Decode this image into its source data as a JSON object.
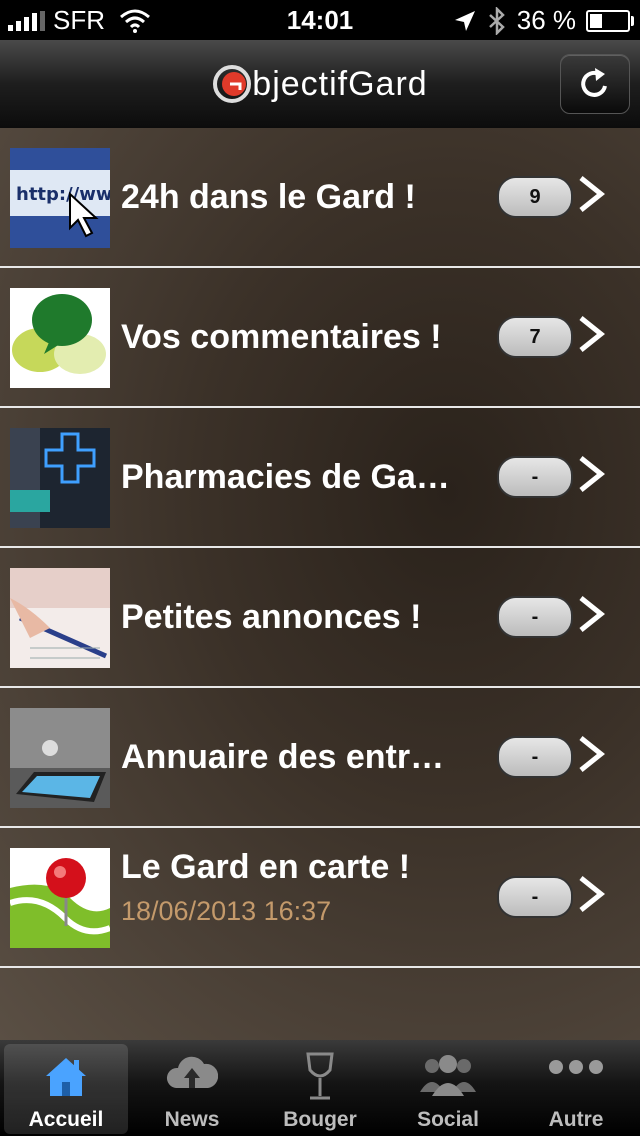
{
  "status_bar": {
    "carrier": "SFR",
    "time": "14:01",
    "battery": "36 %",
    "battery_level": 0.36
  },
  "nav": {
    "logo_text": "bjectifGard",
    "refresh_icon": "refresh-icon"
  },
  "list": [
    {
      "title": "24h dans le Gard !",
      "badge": "9",
      "thumb": "http-link-thumbnail"
    },
    {
      "title": "Vos commentaires !",
      "badge": "7",
      "thumb": "speech-bubbles-thumbnail"
    },
    {
      "title": "Pharmacies de Ga…",
      "badge": "-",
      "thumb": "pharmacy-cross-thumbnail"
    },
    {
      "title": "Petites annonces !",
      "badge": "-",
      "thumb": "pen-writing-thumbnail"
    },
    {
      "title": "Annuaire des entr…",
      "badge": "-",
      "thumb": "tablet-business-thumbnail"
    },
    {
      "title": "Le Gard en carte !",
      "subtitle": "18/06/2013 16:37",
      "badge": "-",
      "thumb": "map-pin-thumbnail"
    }
  ],
  "tabs": [
    {
      "label": "Accueil",
      "icon": "home-icon",
      "active": true
    },
    {
      "label": "News",
      "icon": "cloud-upload-icon"
    },
    {
      "label": "Bouger",
      "icon": "wine-glass-icon"
    },
    {
      "label": "Social",
      "icon": "people-icon"
    },
    {
      "label": "Autre",
      "icon": "more-dots-icon"
    }
  ],
  "colors": {
    "subtitle": "#c49a6b",
    "logo_red": "#e03a2a",
    "active_tab_icon": "#4aa3ff"
  }
}
